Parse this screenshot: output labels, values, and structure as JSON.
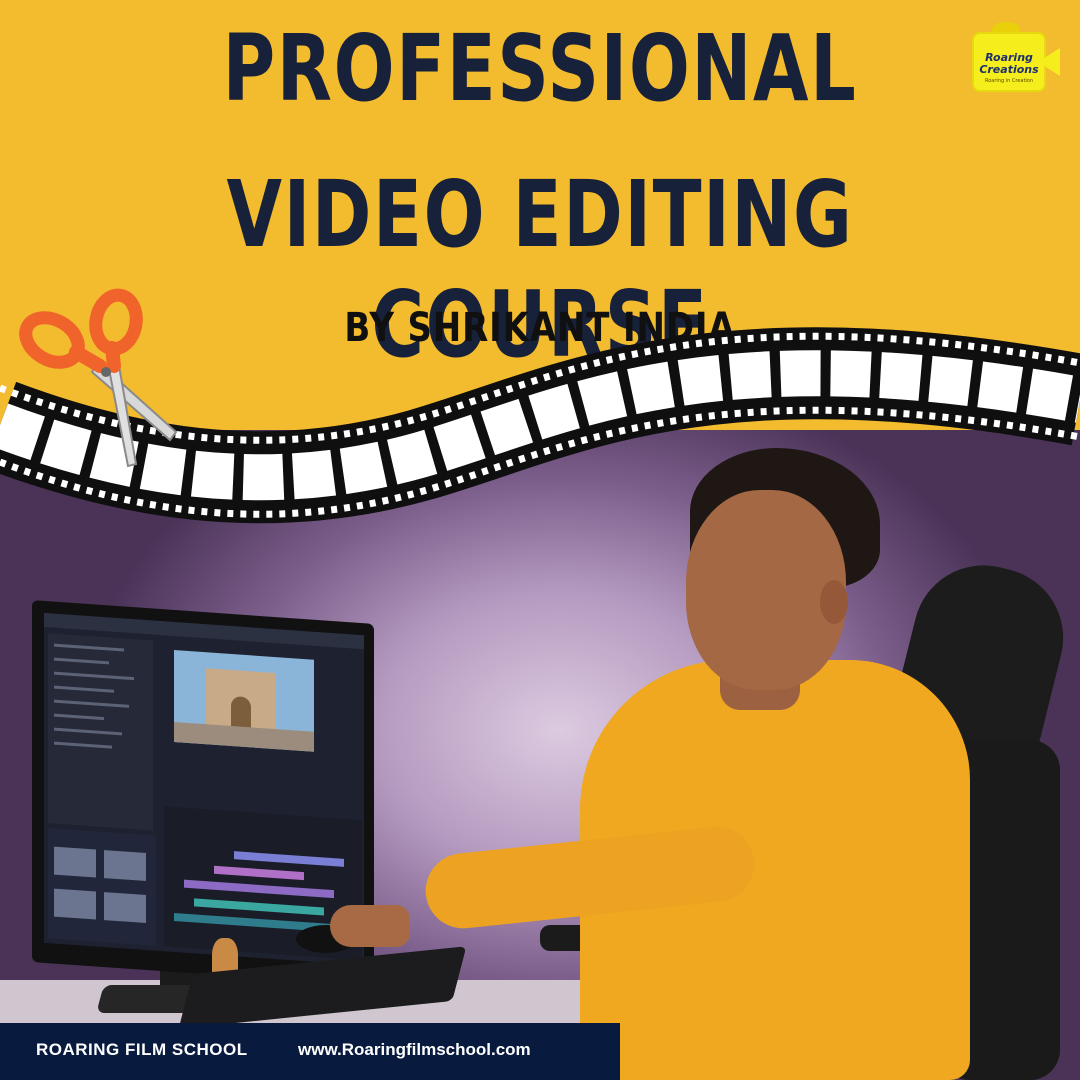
{
  "headline": {
    "line1": "PROFESSIONAL",
    "line2": "VIDEO EDITING COURSE",
    "byline": "BY SHRIKANT INDIA"
  },
  "logo": {
    "line1": "Roaring",
    "line2": "Creations",
    "tagline": "Roaring in Creation"
  },
  "footer": {
    "school_name": "ROARING FILM SCHOOL",
    "website": "www.Roaringfilmschool.com"
  },
  "colors": {
    "banner_yellow": "#f3bb2e",
    "headline_navy": "#17213a",
    "footer_navy": "#091a3f",
    "shirt_yellow": "#f0a820",
    "scissors_orange": "#f0632b"
  },
  "icons": [
    "scissors-icon",
    "film-strip",
    "camera-logo-icon"
  ]
}
